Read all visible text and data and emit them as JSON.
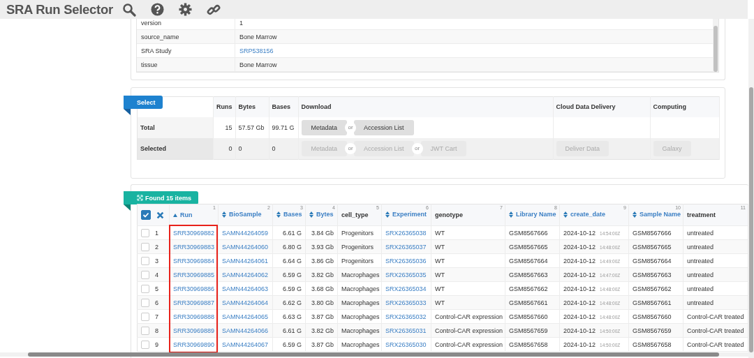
{
  "app_title": "SRA Run Selector",
  "toolbar": [
    {
      "kind": "search"
    },
    {
      "kind": "help"
    },
    {
      "kind": "settings"
    },
    {
      "kind": "link"
    }
  ],
  "attributes": [
    {
      "name": "version",
      "value": "1",
      "link": false
    },
    {
      "name": "source_name",
      "value": "Bone Marrow",
      "link": false
    },
    {
      "name": "SRA Study",
      "value": "SRP538156",
      "link": true
    },
    {
      "name": "tissue",
      "value": "Bone Marrow",
      "link": false
    }
  ],
  "select_panel": {
    "tag": "Select",
    "headers": [
      "Runs",
      "Bytes",
      "Bases",
      "Download",
      "Cloud Data Delivery",
      "Computing"
    ],
    "rows": [
      {
        "label": "Total",
        "runs": "15",
        "bytes": "57.57 Gb",
        "bases": "99.71 G",
        "download": [
          {
            "label": "Metadata",
            "disabled": false
          },
          {
            "separator": "or",
            "label": "Accession List",
            "disabled": false
          }
        ],
        "cloud": [],
        "computing": []
      },
      {
        "label": "Selected",
        "runs": "0",
        "bytes": "0",
        "bases": "0",
        "download": [
          {
            "label": "Metadata",
            "disabled": true
          },
          {
            "separator": "or",
            "label": "Accession List",
            "disabled": true
          },
          {
            "separator": "or",
            "label": "JWT Cart",
            "disabled": true
          }
        ],
        "cloud": [
          {
            "label": "Deliver Data",
            "disabled": true
          }
        ],
        "computing": [
          {
            "label": "Galaxy",
            "disabled": true
          }
        ]
      }
    ]
  },
  "results": {
    "tag": "Found 15 items",
    "select_all_checked": true,
    "columns": [
      {
        "label": "Run",
        "number": "1",
        "sortable": true,
        "sorted": true,
        "kind": "link",
        "highlighted": true
      },
      {
        "label": "BioSample",
        "number": "2",
        "sortable": true,
        "sorted": false,
        "kind": "link",
        "highlighted": false
      },
      {
        "label": "Bases",
        "number": "3",
        "sortable": true,
        "sorted": false,
        "kind": "number",
        "highlighted": false
      },
      {
        "label": "Bytes",
        "number": "4",
        "sortable": true,
        "sorted": false,
        "kind": "number",
        "highlighted": false
      },
      {
        "label": "cell_type",
        "number": "5",
        "sortable": false,
        "kind": "text",
        "highlighted": false
      },
      {
        "label": "Experiment",
        "number": "6",
        "sortable": true,
        "sorted": false,
        "kind": "link",
        "highlighted": false
      },
      {
        "label": "genotype",
        "number": "7",
        "sortable": false,
        "kind": "text",
        "highlighted": false
      },
      {
        "label": "Library Name",
        "number": "8",
        "sortable": true,
        "sorted": false,
        "kind": "text",
        "highlighted": false
      },
      {
        "label": "create_date",
        "number": "9",
        "sortable": true,
        "sorted": false,
        "kind": "date",
        "highlighted": false
      },
      {
        "label": "Sample Name",
        "number": "10",
        "sortable": true,
        "sorted": false,
        "kind": "text",
        "highlighted": false
      },
      {
        "label": "treatment",
        "number": "11",
        "sortable": false,
        "kind": "text",
        "highlighted": false
      }
    ],
    "rows": [
      {
        "number": "1",
        "selected": false,
        "cells": [
          "SRR30969882",
          "SAMN44264059",
          "6.61 G",
          "3.84 Gb",
          "Progenitors",
          "SRX26365038",
          "WT",
          "GSM8567666",
          {
            "date": "2024-10-12",
            "time": "14:54:00Z"
          },
          "GSM8567666",
          "untreated"
        ]
      },
      {
        "number": "2",
        "selected": false,
        "cells": [
          "SRR30969883",
          "SAMN44264060",
          "6.80 G",
          "3.93 Gb",
          "Progenitors",
          "SRX26365037",
          "WT",
          "GSM8567665",
          {
            "date": "2024-10-12",
            "time": "14:48:00Z"
          },
          "GSM8567665",
          "untreated"
        ]
      },
      {
        "number": "3",
        "selected": false,
        "cells": [
          "SRR30969884",
          "SAMN44264061",
          "6.64 G",
          "3.86 Gb",
          "Progenitors",
          "SRX26365036",
          "WT",
          "GSM8567664",
          {
            "date": "2024-10-12",
            "time": "14:49:00Z"
          },
          "GSM8567664",
          "untreated"
        ]
      },
      {
        "number": "4",
        "selected": false,
        "cells": [
          "SRR30969885",
          "SAMN44264062",
          "6.59 G",
          "3.82 Gb",
          "Macrophages",
          "SRX26365035",
          "WT",
          "GSM8567663",
          {
            "date": "2024-10-12",
            "time": "14:47:00Z"
          },
          "GSM8567663",
          "untreated"
        ]
      },
      {
        "number": "5",
        "selected": false,
        "cells": [
          "SRR30969886",
          "SAMN44264063",
          "6.59 G",
          "3.68 Gb",
          "Macrophages",
          "SRX26365034",
          "WT",
          "GSM8567662",
          {
            "date": "2024-10-12",
            "time": "14:48:00Z"
          },
          "GSM8567662",
          "untreated"
        ]
      },
      {
        "number": "6",
        "selected": false,
        "cells": [
          "SRR30969887",
          "SAMN44264064",
          "6.62 G",
          "3.80 Gb",
          "Macrophages",
          "SRX26365033",
          "WT",
          "GSM8567661",
          {
            "date": "2024-10-12",
            "time": "14:48:00Z"
          },
          "GSM8567661",
          "untreated"
        ]
      },
      {
        "number": "7",
        "selected": false,
        "cells": [
          "SRR30969888",
          "SAMN44264065",
          "6.63 G",
          "3.87 Gb",
          "Macrophages",
          "SRX26365032",
          "Control-CAR expression",
          "GSM8567660",
          {
            "date": "2024-10-12",
            "time": "14:48:00Z"
          },
          "GSM8567660",
          "Control-CAR treated"
        ]
      },
      {
        "number": "8",
        "selected": false,
        "cells": [
          "SRR30969889",
          "SAMN44264066",
          "6.61 G",
          "3.82 Gb",
          "Macrophages",
          "SRX26365031",
          "Control-CAR expression",
          "GSM8567659",
          {
            "date": "2024-10-12",
            "time": "14:50:00Z"
          },
          "GSM8567659",
          "Control-CAR treated"
        ]
      },
      {
        "number": "9",
        "selected": false,
        "cells": [
          "SRR30969890",
          "SAMN44264067",
          "6.59 G",
          "3.87 Gb",
          "Macrophages",
          "SRX26365030",
          "Control-CAR expression",
          "GSM8567658",
          {
            "date": "2024-10-12",
            "time": "14:50:00Z"
          },
          "GSM8567658",
          "Control-CAR treated"
        ]
      }
    ]
  }
}
